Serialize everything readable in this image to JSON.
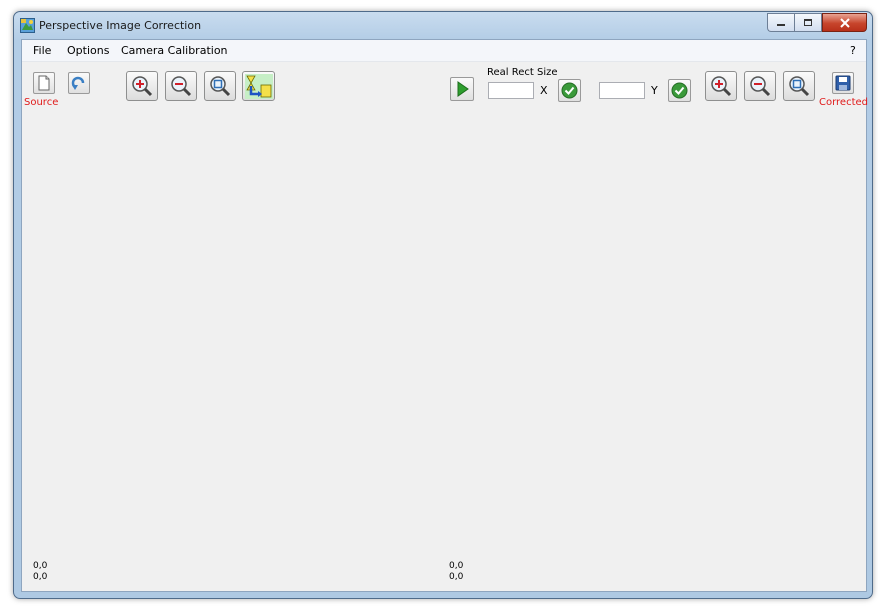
{
  "window": {
    "title": "Perspective Image Correction"
  },
  "menu": {
    "items": [
      "File",
      "Options",
      "Camera Calibration"
    ],
    "help": "?"
  },
  "toolbar_left": {
    "source_label": "Source",
    "icons": [
      "open-file-icon",
      "rotate-icon",
      "zoom-in-icon",
      "zoom-out-icon",
      "zoom-fit-icon",
      "transform-icon"
    ]
  },
  "toolbar_right": {
    "real_rect_size_label": "Real Rect Size",
    "x_label": "X",
    "y_label": "Y",
    "x_value": "",
    "y_value": "",
    "corrected_label": "Corrected",
    "icons": [
      "play-icon",
      "apply-check-icon",
      "zoom-in-icon",
      "zoom-out-icon",
      "zoom-fit-icon",
      "save-icon"
    ]
  },
  "status": {
    "left": {
      "line1": "0,0",
      "line2": "0,0"
    },
    "right": {
      "line1": "0,0",
      "line2": "0,0"
    }
  },
  "colors": {
    "label_red": "#e01b1b",
    "check_green": "#3a9a3a",
    "play_green": "#2e9e2e"
  }
}
